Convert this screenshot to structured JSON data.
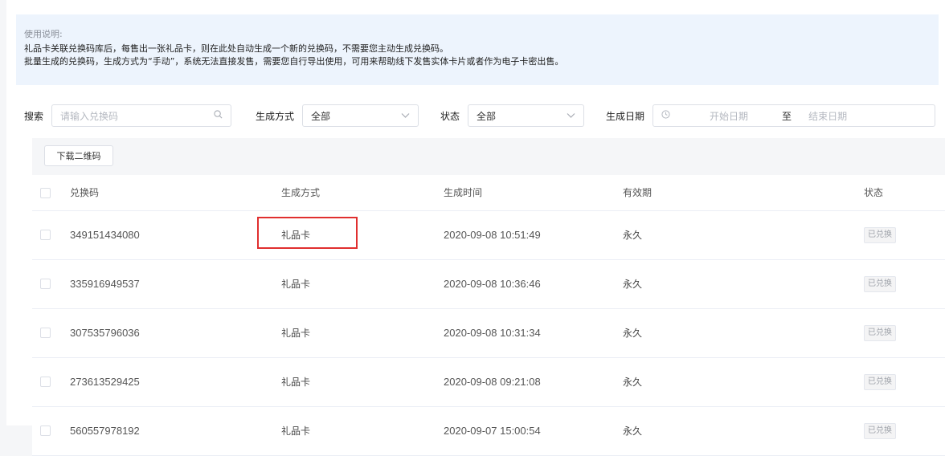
{
  "notice": {
    "title": "使用说明:",
    "lines": [
      "礼品卡关联兑换码库后，每售出一张礼品卡，则在此处自动生成一个新的兑换码，不需要您主动生成兑换码。",
      "批量生成的兑换码，生成方式为“手动”，系统无法直接发售，需要您自行导出使用，可用来帮助线下发售实体卡片或者作为电子卡密出售。"
    ]
  },
  "filters": {
    "search_label": "搜索",
    "search_placeholder": "请输入兑换码",
    "method_label": "生成方式",
    "method_value": "全部",
    "status_label": "状态",
    "status_value": "全部",
    "date_label": "生成日期",
    "date_start_placeholder": "开始日期",
    "date_sep": "至",
    "date_end_placeholder": "结束日期"
  },
  "toolbar": {
    "download_label": "下载二维码"
  },
  "table": {
    "headers": [
      "兑换码",
      "生成方式",
      "生成时间",
      "有效期",
      "状态"
    ],
    "rows": [
      {
        "code": "349151434080",
        "method": "礼品卡",
        "time": "2020-09-08 10:51:49",
        "validity": "永久",
        "status": "已兑换"
      },
      {
        "code": "335916949537",
        "method": "礼品卡",
        "time": "2020-09-08 10:36:46",
        "validity": "永久",
        "status": "已兑换"
      },
      {
        "code": "307535796036",
        "method": "礼品卡",
        "time": "2020-09-08 10:31:34",
        "validity": "永久",
        "status": "已兑换"
      },
      {
        "code": "273613529425",
        "method": "礼品卡",
        "time": "2020-09-08 09:21:08",
        "validity": "永久",
        "status": "已兑换"
      },
      {
        "code": "560557978192",
        "method": "礼品卡",
        "time": "2020-09-07 15:00:54",
        "validity": "永久",
        "status": "已兑换"
      }
    ]
  },
  "colors": {
    "notice_bg": "#edf4fd",
    "highlight": "#e02f2f"
  }
}
